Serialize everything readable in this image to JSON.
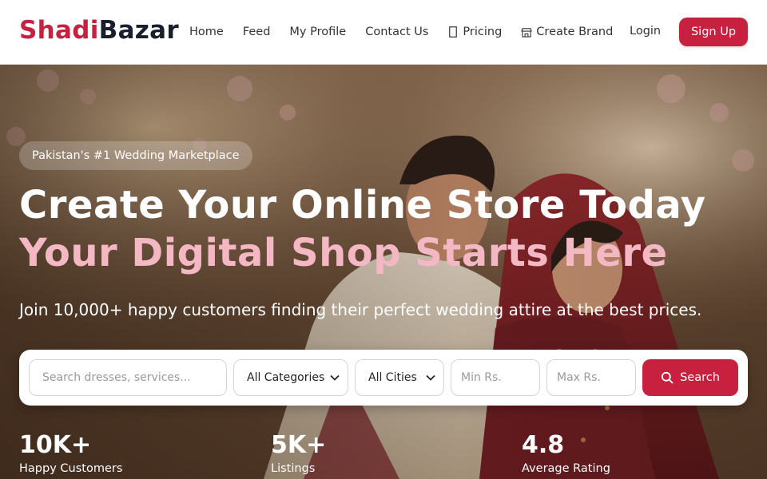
{
  "brand": {
    "part1": "Shadi",
    "part2": "Bazar"
  },
  "nav": {
    "items": [
      {
        "label": "Home",
        "icon": ""
      },
      {
        "label": "Feed",
        "icon": ""
      },
      {
        "label": "My Profile",
        "icon": ""
      },
      {
        "label": "Contact Us",
        "icon": ""
      },
      {
        "label": "Pricing",
        "icon": "tag-icon"
      },
      {
        "label": "Create Brand",
        "icon": "store-icon"
      }
    ],
    "login": "Login",
    "signup": "Sign Up"
  },
  "hero": {
    "badge": "Pakistan's #1 Wedding Marketplace",
    "title_line1": "Create Your Online Store Today",
    "title_line2": "Your Digital Shop Starts Here",
    "subtitle": "Join 10,000+ happy customers finding their perfect wedding attire at the best prices."
  },
  "search": {
    "query_placeholder": "Search dresses, services...",
    "category_selected": "All Categories",
    "city_selected": "All Cities",
    "min_placeholder": "Min Rs.",
    "max_placeholder": "Max Rs.",
    "button_label": "Search"
  },
  "stats": [
    {
      "value": "10K+",
      "label": "Happy Customers"
    },
    {
      "value": "5K+",
      "label": "Listings"
    },
    {
      "value": "4.8",
      "label": "Average Rating"
    }
  ],
  "colors": {
    "accent": "#c8203f",
    "dark": "#1a1f2e",
    "highlight": "#f3b8c4"
  }
}
